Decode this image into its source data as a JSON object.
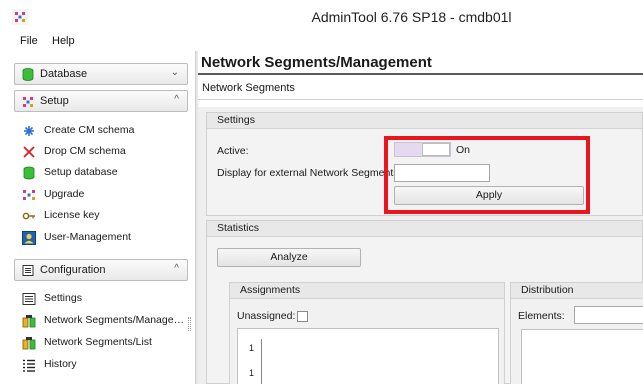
{
  "window": {
    "title": "AdminTool 6.76 SP18 - cmdb01l"
  },
  "menu": [
    "File",
    "Help"
  ],
  "sidebar": {
    "sections": [
      {
        "label": "Database",
        "icon": "database-icon",
        "chevron": "⌄"
      },
      {
        "label": "Setup",
        "icon": "setup-icon",
        "chevron": "^"
      },
      {
        "label": "Configuration",
        "icon": "configuration-icon",
        "chevron": "^"
      }
    ],
    "setup_items": [
      {
        "label": "Create CM schema",
        "icon": "create-schema-icon"
      },
      {
        "label": "Drop CM schema",
        "icon": "drop-schema-icon"
      },
      {
        "label": "Setup database",
        "icon": "database-icon"
      },
      {
        "label": "Upgrade",
        "icon": "upgrade-icon"
      },
      {
        "label": "License key",
        "icon": "key-icon"
      },
      {
        "label": "User-Management",
        "icon": "user-management-icon"
      }
    ],
    "config_items": [
      {
        "label": "Settings",
        "icon": "settings-list-icon"
      },
      {
        "label": "Network Segments/Manage…",
        "icon": "network-segments-icon"
      },
      {
        "label": "Network Segments/List",
        "icon": "network-list-icon"
      },
      {
        "label": "History",
        "icon": "history-icon"
      }
    ]
  },
  "main": {
    "title": "Network Segments/Management",
    "subtitle": "Network Segments",
    "settings": {
      "header": "Settings",
      "active_label": "Active:",
      "active_state": "On",
      "external_label": "Display for external Network Segments:",
      "external_value": "",
      "apply_label": "Apply"
    },
    "statistics": {
      "header": "Statistics",
      "analyze_label": "Analyze",
      "assignments_header": "Assignments",
      "unassigned_label": "Unassigned:",
      "distribution_header": "Distribution",
      "elements_label": "Elements:",
      "tick_labels": [
        "1",
        "1"
      ]
    }
  },
  "colors": {
    "highlight": "#e8161f",
    "toggle_track": "#e5d9f0"
  }
}
